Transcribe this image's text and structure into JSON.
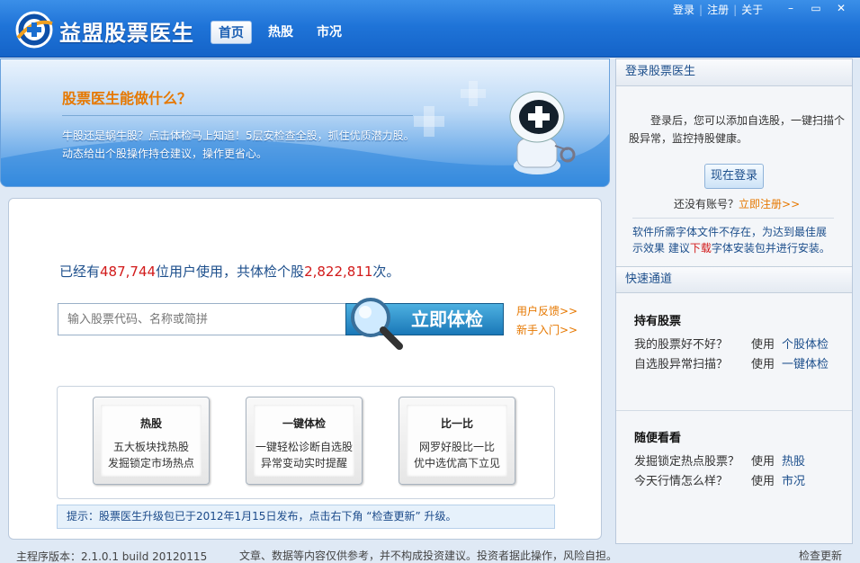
{
  "app": {
    "title": "益盟股票医生"
  },
  "nav": {
    "tabs": [
      {
        "label": "首页"
      },
      {
        "label": "热股"
      },
      {
        "label": "市况"
      }
    ]
  },
  "top_links": {
    "login": "登录",
    "register": "注册",
    "about": "关于",
    "sep": "|"
  },
  "window_controls": {
    "minimize": "–",
    "maximize": "▭",
    "close": "✕"
  },
  "banner": {
    "title": "股票医生能做什么？",
    "line1": "牛股还是蜗牛股？点击体检马上知道！5层安检查全股，抓住优质潜力股。",
    "line2": "动态给出个股操作持仓建议，操作更省心。"
  },
  "stats": {
    "prefix": "已经有",
    "users": "487,744",
    "middle": "位用户使用，共体检个股",
    "checks": "2,822,811",
    "suffix": "次。"
  },
  "search": {
    "placeholder": "输入股票代码、名称或简拼",
    "button": "立即体检"
  },
  "side_links": {
    "feedback": "用户反馈>>",
    "newbie": "新手入门>>"
  },
  "cards": [
    {
      "title": "热股",
      "line1": "五大板块找热股",
      "line2": "发掘锁定市场热点"
    },
    {
      "title": "一键体检",
      "line1": "一键轻松诊断自选股",
      "line2": "异常变动实时提醒"
    },
    {
      "title": "比一比",
      "line1": "网罗好股比一比",
      "line2": "优中选优高下立见"
    }
  ],
  "tip": "提示：股票医生升级包已于2012年1月15日发布，点击右下角 “检查更新” 升级。",
  "footer": {
    "version": "主程序版本：2.1.0.1 build 20120115",
    "disclaimer": "文章、数据等内容仅供参考，并不构成投资建议。投资者据此操作，风险自担。",
    "update": "检查更新"
  },
  "right_panel": {
    "login_head": "登录股票医生",
    "login_desc": "登录后，您可以添加自选股，一键扫描个股异常，监控持股健康。",
    "login_button": "现在登录",
    "no_account": "还没有账号？",
    "register_now": "立即注册>>",
    "font_note_a": "软件所需字体文件不存在，为达到最佳展示效果 建议",
    "font_note_dl": "下载",
    "font_note_b": "字体安装包并进行安装。",
    "quick_head": "快速通道",
    "hold_title": "持有股票",
    "hold_rows": [
      {
        "q": "我的股票好不好？",
        "use": "使用",
        "act": "个股体检"
      },
      {
        "q": "自选股异常扫描？",
        "use": "使用",
        "act": "一键体检"
      }
    ],
    "look_title": "随便看看",
    "look_rows": [
      {
        "q": "发掘锁定热点股票？",
        "use": "使用",
        "act": "热股"
      },
      {
        "q": "今天行情怎么样？",
        "use": "使用",
        "act": "市况"
      }
    ]
  }
}
